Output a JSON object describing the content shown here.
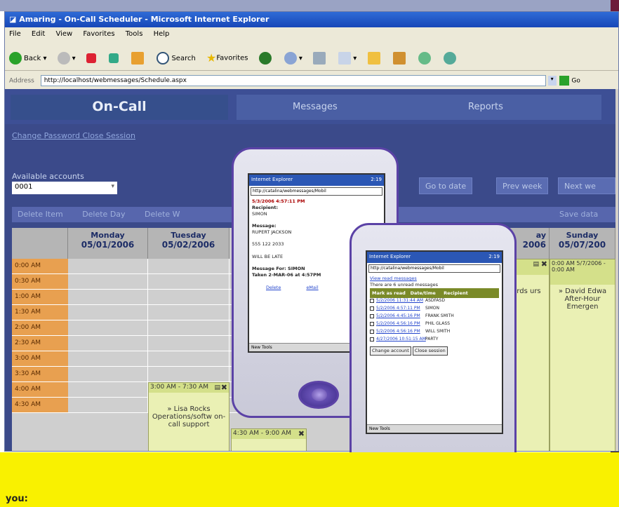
{
  "window": {
    "title": "Amaring - On-Call Scheduler - Microsoft Internet Explorer"
  },
  "menu": [
    "File",
    "Edit",
    "View",
    "Favorites",
    "Tools",
    "Help"
  ],
  "toolbar": {
    "back": "Back",
    "search": "Search",
    "favorites": "Favorites"
  },
  "address": {
    "label": "Address",
    "url": "http://localhost/webmessages/Schedule.aspx",
    "go": "Go"
  },
  "nav": {
    "oncall": "On-Call",
    "messages": "Messages",
    "reports": "Reports"
  },
  "links": {
    "change_password": "Change Password",
    "close_session": "Close Session"
  },
  "accounts": {
    "label": "Available accounts",
    "selected": "0001"
  },
  "date_buttons": {
    "go_to_date": "Go to date",
    "prev_week": "Prev week",
    "next_week": "Next we"
  },
  "actions": {
    "delete_item": "Delete Item",
    "delete_day": "Delete Day",
    "delete_w": "Delete W",
    "save_data": "Save data"
  },
  "days": [
    {
      "name": "Monday",
      "date": "05/01/2006"
    },
    {
      "name": "Tuesday",
      "date": "05/02/2006"
    },
    {
      "name": "",
      "date": "2006"
    },
    {
      "name": "Sunday",
      "date": "05/07/200"
    }
  ],
  "times": [
    "0:00 AM",
    "0:30 AM",
    "1:00 AM",
    "1:30 AM",
    "2:00 AM",
    "2:30 AM",
    "3:00 AM",
    "3:30 AM",
    "4:00 AM",
    "4:30 AM"
  ],
  "events": {
    "tue_head": "3:00 AM - 7:30 AM",
    "tue_body": "» Lisa Rocks Operations/softw on-call support",
    "wed_head": "4:30 AM - 9:00 AM",
    "sat_body": "wards urs ky",
    "sun_head": "0:00 AM 5/7/2006 - 0:00 AM",
    "sun_body": "» David Edwa After-Hour Emergen"
  },
  "pda1": {
    "title": "Internet Explorer",
    "time": "2:19",
    "url": "http://catalina/webmessages/Mobil",
    "body": [
      "5/3/2006 4:57:11 PM",
      "Recipient:",
      "SIMON",
      "Message:",
      "RUPERT JACKSON",
      "555 122 2033",
      "WILL BE LATE",
      "Message For: SIMON",
      "Taken 2-MAR-06 at 4:57PM"
    ],
    "links": [
      "Delete",
      "eMail"
    ],
    "footer": "New Tools"
  },
  "pda2": {
    "title": "Internet Explorer",
    "time": "2:19",
    "url": "http://catalina/webmessages/Mobil",
    "intro_link": "View read messages",
    "intro_text": "There are 6 unread messages",
    "headers": [
      "Mark as read",
      "Date/time",
      "Recipient"
    ],
    "rows": [
      {
        "date": "5/2/2006 11:31:44 AM",
        "recipient": "ASDFASD"
      },
      {
        "date": "5/2/2006 4:57:11 PM",
        "recipient": "SIMON"
      },
      {
        "date": "5/2/2006 4:45:16 PM",
        "recipient": "FRANK SMITH"
      },
      {
        "date": "5/2/2006 4:56:16 PM",
        "recipient": "PHIL GLASS"
      },
      {
        "date": "5/2/2006 4:56:16 PM",
        "recipient": "WILL SMITH"
      },
      {
        "date": "4/27/2006 10:51:15 AM",
        "recipient": "PARTY"
      }
    ],
    "buttons": [
      "Change account",
      "Close session"
    ],
    "footer": "New Tools"
  },
  "banner": {
    "text": "you:"
  }
}
